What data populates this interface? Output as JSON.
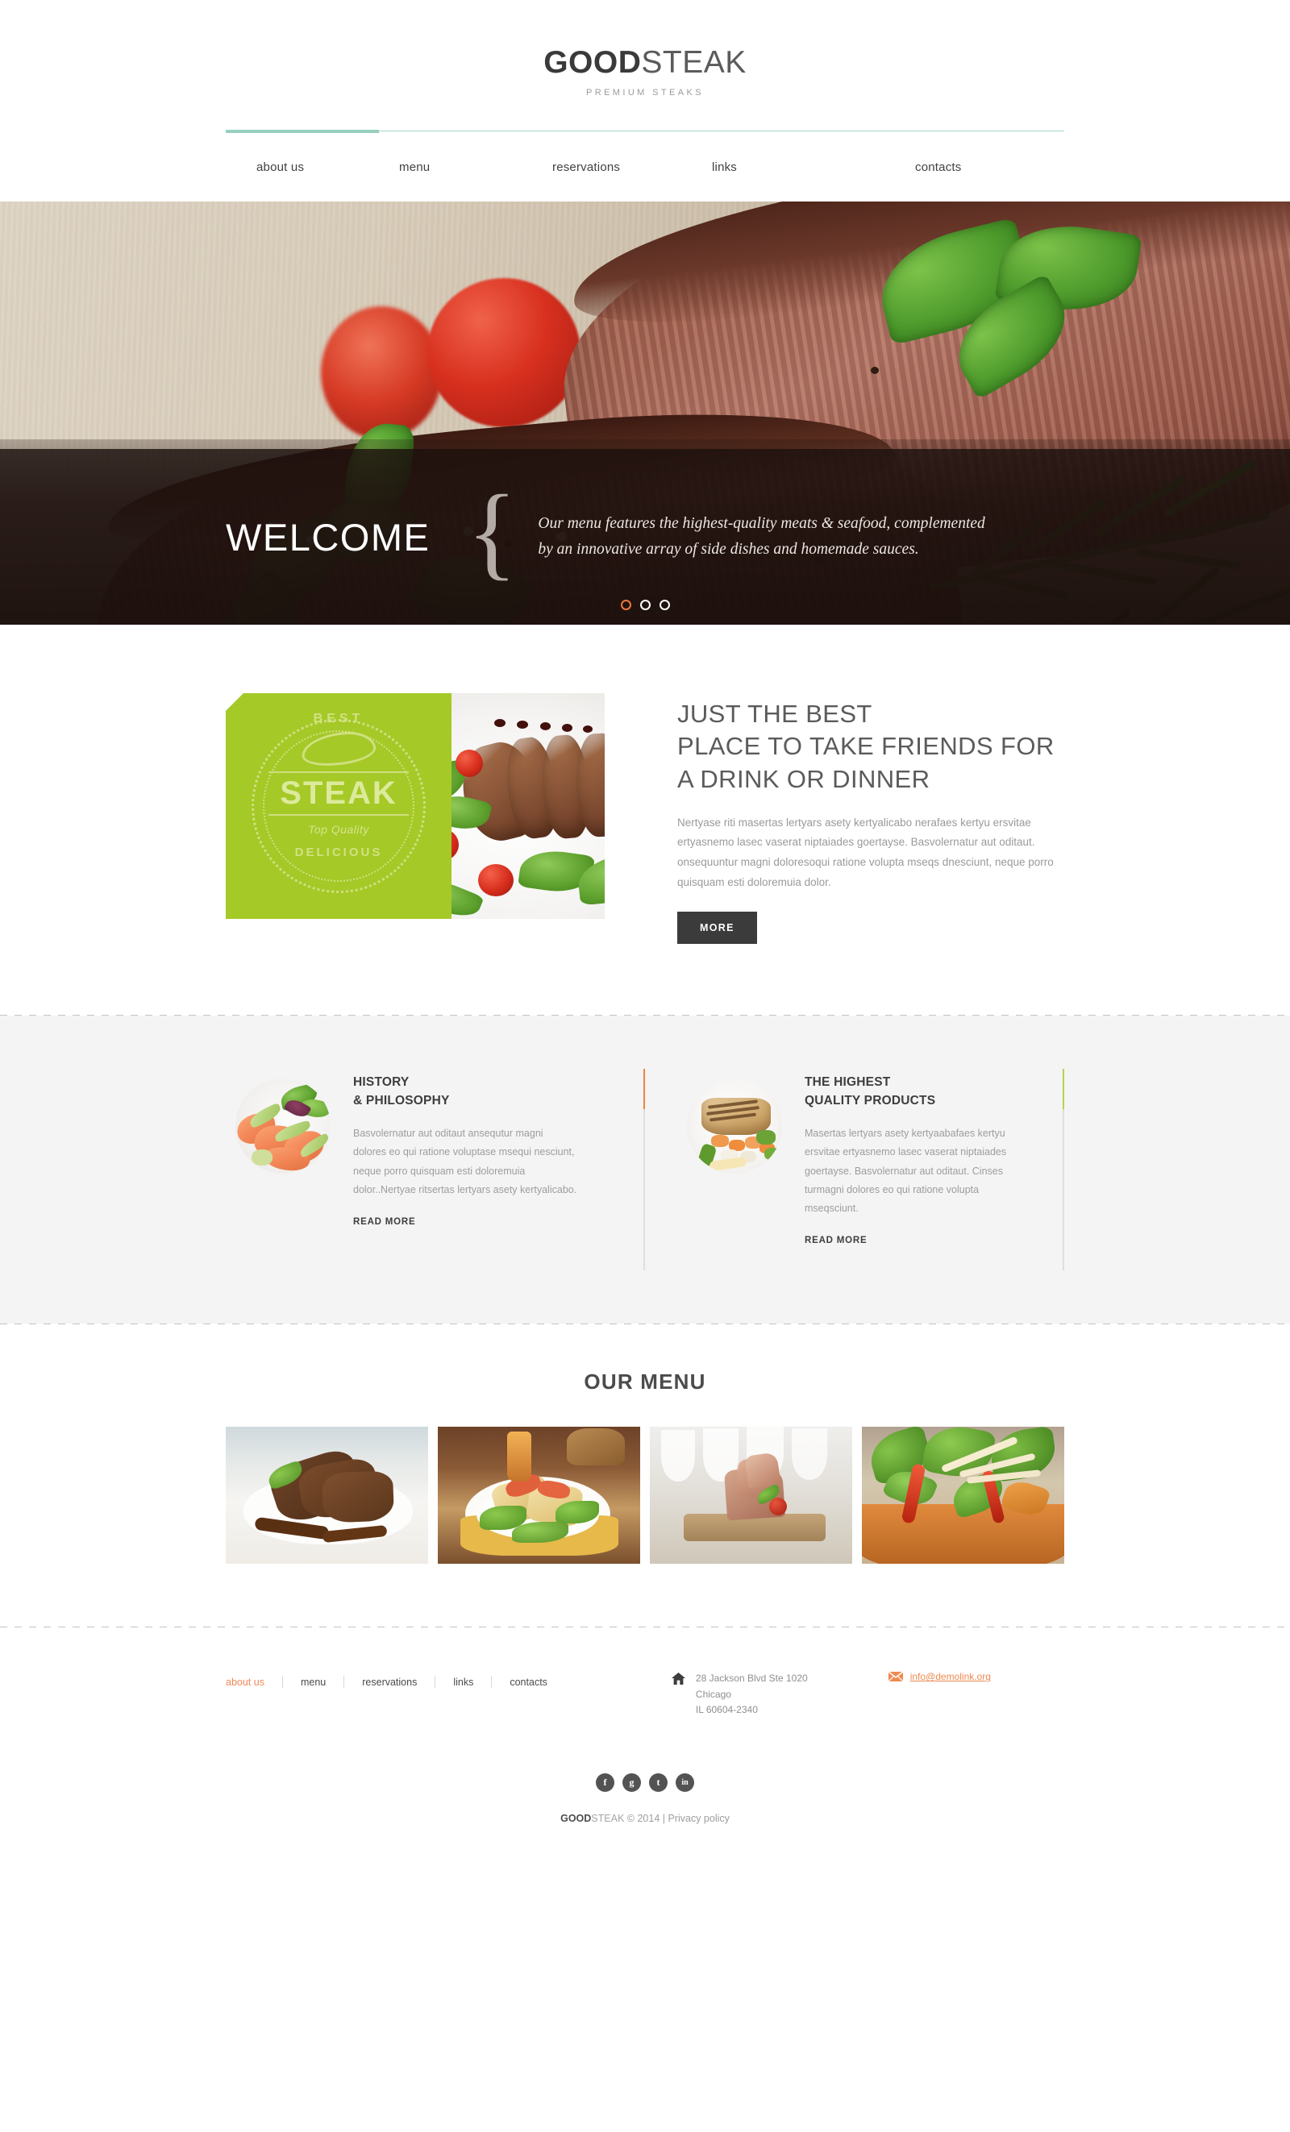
{
  "header": {
    "logo_bold": "GOOD",
    "logo_light": "STEAK",
    "tagline": "PREMIUM STEAKS"
  },
  "nav": {
    "items": [
      {
        "label": "about us",
        "active": true
      },
      {
        "label": "menu",
        "active": false
      },
      {
        "label": "reservations",
        "active": false
      },
      {
        "label": "links",
        "active": false
      },
      {
        "label": "contacts",
        "active": false
      }
    ]
  },
  "hero": {
    "image_alt": "grilled steak closeup with basil, cherry tomatoes and rosemary",
    "slider_dots": 3,
    "active_dot": 0,
    "active_dot_color": "#f0763c"
  },
  "welcome": {
    "title": "WELCOME",
    "brace": "{",
    "text": "Our menu features the highest-quality meats & seafood, complemented by an innovative array of side dishes and homemade sauces."
  },
  "best": {
    "badge": {
      "top_text": "BEST",
      "main_text": "STEAK",
      "sub_text": "Top Quality",
      "bottom_text": "DELICIOUS",
      "background": "#a5c927"
    },
    "photo_alt": "sliced roast beef with arugula, cherry tomatoes and balsamic",
    "heading_line1": "JUST THE BEST",
    "heading_line2": "PLACE TO TAKE FRIENDS FOR",
    "heading_line3": "A DRINK OR DINNER",
    "paragraph": "Nertyase riti masertas lertyars asety kertyalicabo nerafaes kertyu ersvitae ertyasnemo lasec vaserat niptaiades goertayse. Basvolernatur aut oditaut. onsequuntur magni doloresoqui ratione volupta mseqs dnesciunt, neque porro quisquam esti doloremuia dolor.",
    "button_label": "MORE"
  },
  "features": {
    "items": [
      {
        "thumb_alt": "salmon and avocado salad on white plate",
        "heading_line1": "HISTORY",
        "heading_line2": "& PHILOSOPHY",
        "paragraph": "Basvolernatur aut oditaut ansequtur magni dolores eo qui ratione voluptase msequi nesciunt, neque porro quisquam esti doloremuia dolor..Nertyae ritsertas lertyars asety kertyalicabo.",
        "link_label": "READ MORE",
        "accent_color": "#f2803f"
      },
      {
        "thumb_alt": "grilled chicken breast with mixed vegetables",
        "heading_line1": "THE HIGHEST",
        "heading_line2": "QUALITY PRODUCTS",
        "paragraph": "Masertas lertyars asety kertyaabafaes kertyu ersvitae ertyasnemo lasec vaserat niptaiades goertayse. Basvolernatur aut oditaut. Cinses turmagni dolores eo qui ratione volupta mseqsciunt.",
        "link_label": "READ MORE",
        "accent_color": "#b6d44c"
      }
    ]
  },
  "menu": {
    "title": "OUR MENU",
    "items": [
      {
        "alt": "lamb chops with sauce on white plate"
      },
      {
        "alt": "stuffed pastry with tomato sauce and lettuce"
      },
      {
        "alt": "ham and vegetable stack on wooden board"
      },
      {
        "alt": "fresh vegetable salad with sprouts and peppers"
      }
    ]
  },
  "footer": {
    "nav": [
      {
        "label": "about us",
        "active": true
      },
      {
        "label": "menu",
        "active": false
      },
      {
        "label": "reservations",
        "active": false
      },
      {
        "label": "links",
        "active": false
      },
      {
        "label": "contacts",
        "active": false
      }
    ],
    "address_line1": "28 Jackson Blvd Ste 1020",
    "address_line2": "Chicago",
    "address_line3": "IL 60604-2340",
    "email": "info@demolink.org",
    "email_color": "#ee8a50",
    "social": [
      {
        "name": "facebook",
        "glyph": "f"
      },
      {
        "name": "google-plus",
        "glyph": "g"
      },
      {
        "name": "twitter",
        "glyph": "t"
      },
      {
        "name": "linkedin",
        "glyph": "in"
      }
    ],
    "copyright_bold": "GOOD",
    "copyright_light": "STEAK",
    "copyright_text": "© 2014 |",
    "privacy_label": "Privacy policy"
  }
}
